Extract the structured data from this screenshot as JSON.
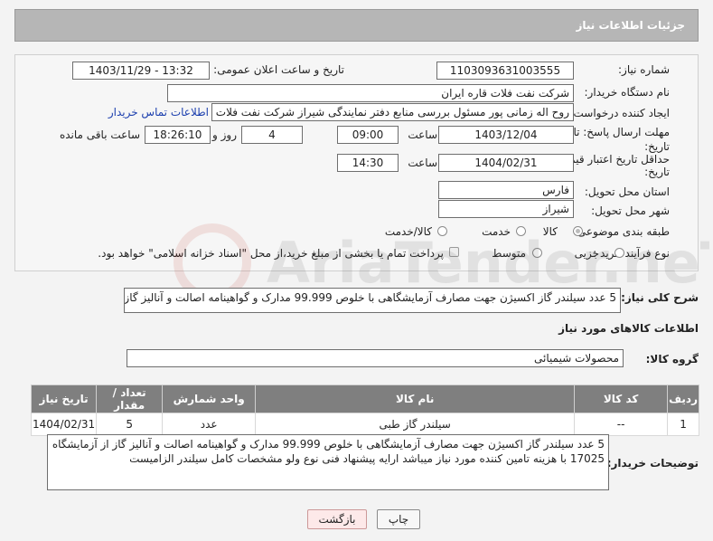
{
  "header": {
    "title": "جزئیات اطلاعات نیاز"
  },
  "form": {
    "need_number_label": "شماره نیاز:",
    "need_number": "1103093631003555",
    "announce_label": "تاریخ و ساعت اعلان عمومی:",
    "announce_value": "1403/11/29 - 13:32",
    "buyer_org_label": "نام دستگاه خریدار:",
    "buyer_org": "شرکت نفت فلات قاره ایران",
    "creator_label": "ایجاد کننده درخواست:",
    "creator": "روح اله زمانی پور مسئول بررسی منابع دفتر نمایندگی شیراز شرکت نفت فلات قاره ایران",
    "contact_link": "اطلاعات تماس خریدار",
    "deadline_label_1": "مهلت ارسال پاسخ: تا",
    "deadline_label_2": "تاریخ:",
    "deadline_date": "1403/12/04",
    "time_label": "ساعت",
    "deadline_time": "09:00",
    "days_value": "4",
    "days_label": "روز و",
    "remaining_time": "18:26:10",
    "remaining_label": "ساعت باقی مانده",
    "validity_label_1": "حداقل تاریخ اعتبار قیمت: تا",
    "validity_label_2": "تاریخ:",
    "validity_date": "1404/02/31",
    "validity_time": "14:30",
    "province_label": "استان محل تحویل:",
    "province": "فارس",
    "city_label": "شهر محل تحویل:",
    "city": "شیراز",
    "category_label": "طبقه بندی موضوعی:",
    "category_options": [
      "کالا",
      "خدمت",
      "کالا/خدمت"
    ],
    "process_label": "نوع فرآیند خرید :",
    "process_options": [
      "جزیی",
      "متوسط"
    ],
    "payment_note": "پرداخت تمام یا بخشی از مبلغ خرید،از محل \"اسناد خزانه اسلامی\" خواهد بود."
  },
  "description": {
    "label": "شرح کلی نیاز:",
    "value": "5 عدد سیلندر گاز اکسیژن جهت مصارف آزمایشگاهی با خلوص 99.999 مدارک و گواهینامه اصالت و آنالیز گاز"
  },
  "goods": {
    "section_title": "اطلاعات کالاهای مورد نیاز",
    "group_label": "گروه کالا:",
    "group_value": "محصولات شیمیائی",
    "columns": [
      "ردیف",
      "کد کالا",
      "نام کالا",
      "واحد شمارش",
      "تعداد / مقدار",
      "تاریخ نیاز"
    ],
    "rows": [
      {
        "row": "1",
        "code": "--",
        "name": "سیلندر گاز طبی",
        "unit": "عدد",
        "qty": "5",
        "date": "1404/02/31"
      }
    ]
  },
  "buyer_notes": {
    "label": "توضیحات خریدار:",
    "value": "5 عدد سیلندر گاز اکسیژن جهت مصارف آزمایشگاهی با خلوص 99.999 مدارک و گواهینامه اصالت و آنالیز گاز از آزمایشگاه 17025 با هزینه تامین کننده مورد نیاز میباشد ارایه پیشنهاد فنی نوع ولو مشخصات کامل سیلندر الزامیست"
  },
  "buttons": {
    "print": "چاپ",
    "back": "بازگشت"
  },
  "watermark": {
    "text": "AriaTender.neT"
  }
}
